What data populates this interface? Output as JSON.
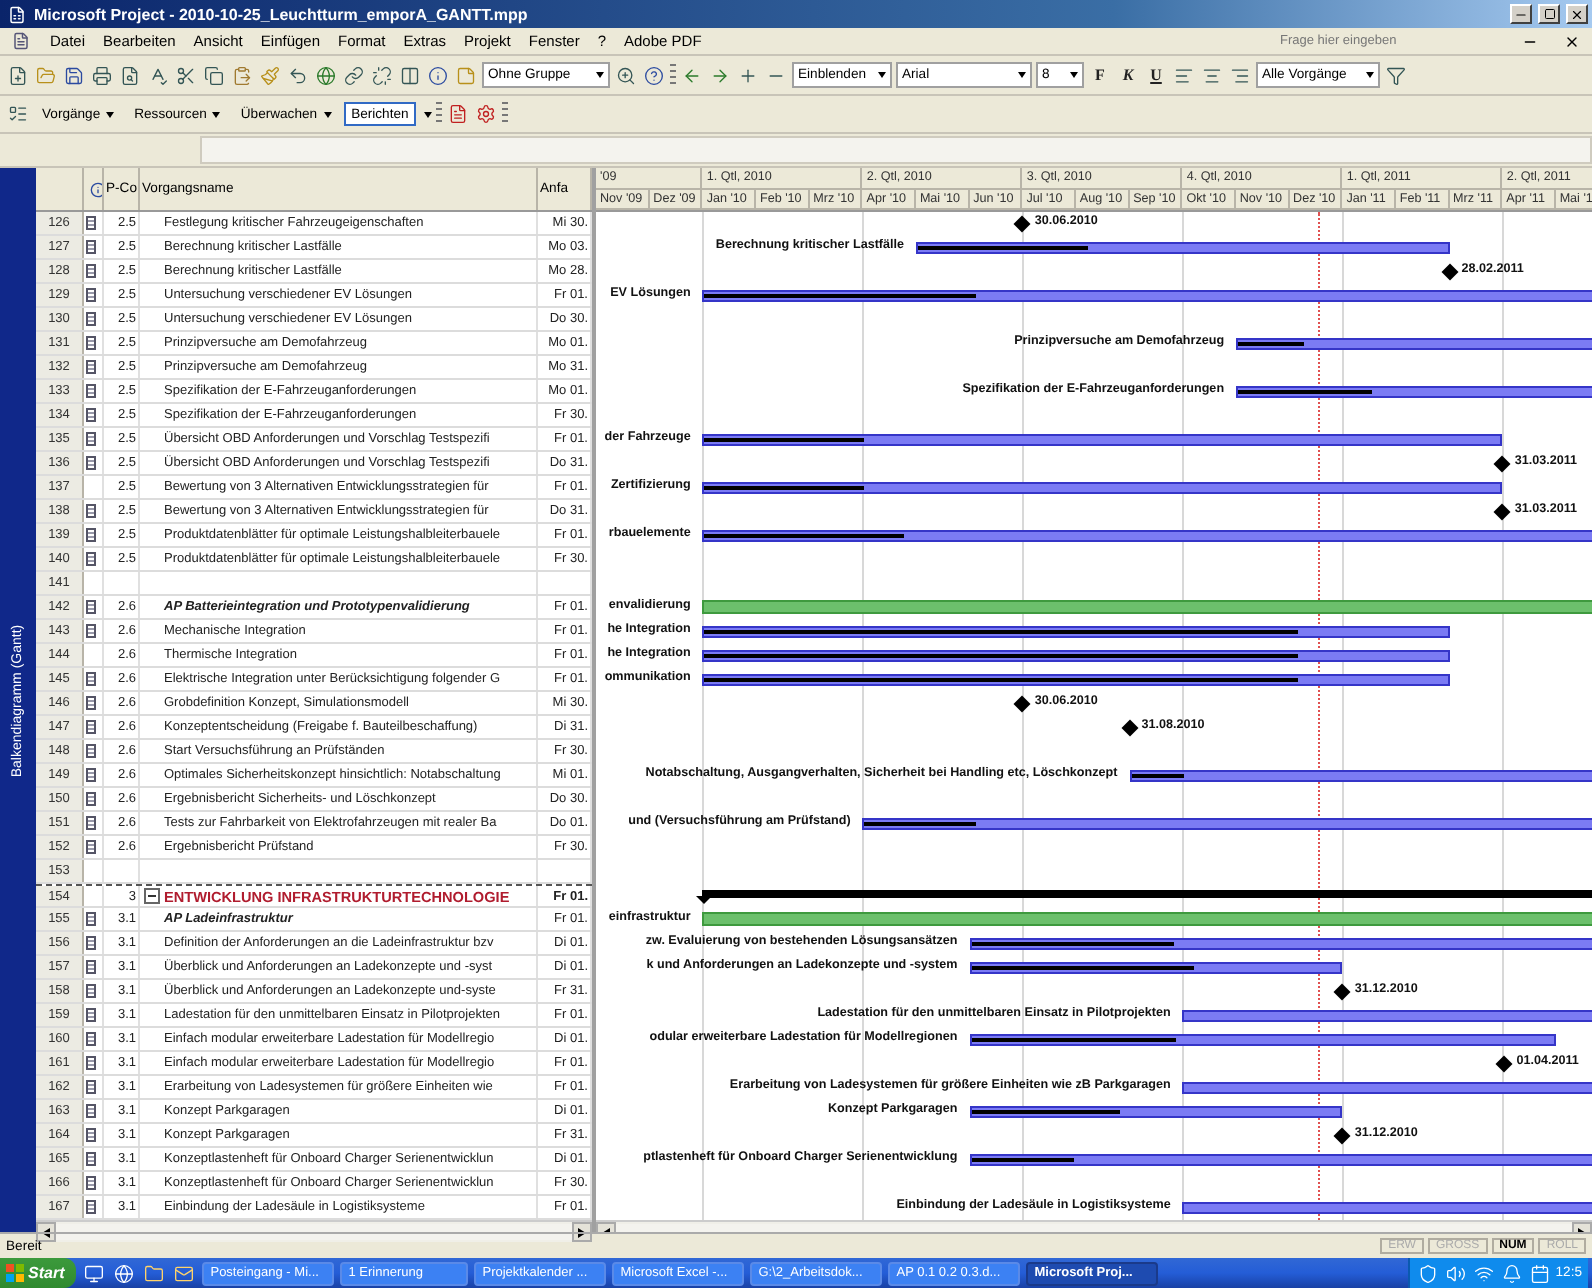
{
  "window": {
    "title": "Microsoft Project - 2010-10-25_Leuchtturm_emporA_GANTT.mpp"
  },
  "menu": [
    "Datei",
    "Bearbeiten",
    "Ansicht",
    "Einfügen",
    "Format",
    "Extras",
    "Projekt",
    "Fenster",
    "?",
    "Adobe PDF"
  ],
  "help_search": {
    "placeholder": "Frage hier eingeben"
  },
  "toolbar": {
    "group": "Ohne Gruppe",
    "show": "Einblenden",
    "font": "Arial",
    "font_size": "8",
    "bold": "F",
    "italic": "K",
    "underline": "U",
    "filter": "Alle Vorgänge"
  },
  "guide_toolbar": [
    {
      "label": "Vorgänge",
      "selected": false
    },
    {
      "label": "Ressourcen",
      "selected": false
    },
    {
      "label": "Überwachen",
      "selected": false
    },
    {
      "label": "Berichten",
      "selected": true
    }
  ],
  "view_bar": {
    "label": "Balkendiagramm (Gantt)"
  },
  "table": {
    "columns": [
      "P-Co",
      "Vorgangsname",
      "Anfa"
    ],
    "rows": [
      {
        "id": "126",
        "note": true,
        "pcode": "2.5",
        "name": "Festlegung kritischer Fahrzeugeigenschaften",
        "start": "Mi 30.",
        "kind": "task",
        "gantt": {
          "kind": "milestone",
          "label": "30.06.2010"
        }
      },
      {
        "id": "127",
        "note": true,
        "pcode": "2.5",
        "name": "Berechnung kritischer Lastfälle",
        "start": "Mo 03.",
        "kind": "task",
        "gantt": {
          "kind": "bar",
          "level": 0.32,
          "label": "Berechnung kritischer Lastfälle"
        }
      },
      {
        "id": "128",
        "note": true,
        "pcode": "2.5",
        "name": "Berechnung kritischer Lastfälle",
        "start": "Mo 28.",
        "kind": "task",
        "gantt": {
          "kind": "milestone",
          "label": "28.02.2011"
        }
      },
      {
        "id": "129",
        "note": true,
        "pcode": "2.5",
        "name": "Untersuchung verschiedener EV Lösungen",
        "start": "Fr 01.",
        "kind": "task",
        "gantt": {
          "kind": "bar",
          "level": 0.3,
          "label": "EV Lösungen"
        }
      },
      {
        "id": "130",
        "note": true,
        "pcode": "2.5",
        "name": "Untersuchung verschiedener EV Lösungen",
        "start": "Do 30.",
        "kind": "task"
      },
      {
        "id": "131",
        "note": true,
        "pcode": "2.5",
        "name": "Prinzipversuche am Demofahrzeug",
        "start": "Mo 01.",
        "kind": "task",
        "gantt": {
          "kind": "bar",
          "level": 0.18,
          "label": "Prinzipversuche am Demofahrzeug"
        }
      },
      {
        "id": "132",
        "note": true,
        "pcode": "2.5",
        "name": "Prinzipversuche am Demofahrzeug",
        "start": "Mo 31.",
        "kind": "task"
      },
      {
        "id": "133",
        "note": true,
        "pcode": "2.5",
        "name": "Spezifikation der E-Fahrzeuganforderungen",
        "start": "Mo 01.",
        "kind": "task",
        "gantt": {
          "kind": "bar",
          "level": 0.36,
          "label": "Spezifikation der E-Fahrzeuganforderungen"
        }
      },
      {
        "id": "134",
        "note": true,
        "pcode": "2.5",
        "name": "Spezifikation der E-Fahrzeuganforderungen",
        "start": "Fr 30.",
        "kind": "task"
      },
      {
        "id": "135",
        "note": true,
        "pcode": "2.5",
        "name": "Übersicht OBD Anforderungen und Vorschlag Testspezifi",
        "start": "Fr 01.",
        "kind": "task",
        "gantt": {
          "kind": "bar",
          "level": 0.2,
          "label": "der Fahrzeuge"
        }
      },
      {
        "id": "136",
        "note": true,
        "pcode": "2.5",
        "name": "Übersicht OBD Anforderungen und Vorschlag Testspezifi",
        "start": "Do 31.",
        "kind": "task",
        "gantt": {
          "kind": "milestone",
          "label": "31.03.2011"
        }
      },
      {
        "id": "137",
        "note": false,
        "pcode": "2.5",
        "name": "Bewertung von 3 Alternativen Entwicklungsstrategien für",
        "start": "Fr 01.",
        "kind": "task",
        "gantt": {
          "kind": "bar",
          "level": 0.2,
          "label": "Zertifizierung"
        }
      },
      {
        "id": "138",
        "note": true,
        "pcode": "2.5",
        "name": "Bewertung von 3 Alternativen Entwicklungsstrategien für",
        "start": "Do 31.",
        "kind": "task",
        "gantt": {
          "kind": "milestone",
          "label": "31.03.2011"
        }
      },
      {
        "id": "139",
        "note": true,
        "pcode": "2.5",
        "name": "Produktdatenblätter für optimale Leistungshalbleiterbauele",
        "start": "Fr 01.",
        "kind": "task",
        "gantt": {
          "kind": "bar",
          "level": 0.22,
          "label": "rbauelemente"
        }
      },
      {
        "id": "140",
        "note": true,
        "pcode": "2.5",
        "name": "Produktdatenblätter für optimale Leistungshalbleiterbauele",
        "start": "Fr 30.",
        "kind": "task"
      },
      {
        "id": "141",
        "note": false,
        "kind": "empty"
      },
      {
        "id": "142",
        "note": true,
        "pcode": "2.6",
        "name": "AP Batterieintegration und Prototypenvalidierung",
        "start": "Fr 01.",
        "kind": "ap",
        "gantt": {
          "kind": "ap-bar",
          "label": "envalidierung"
        }
      },
      {
        "id": "143",
        "note": true,
        "pcode": "2.6",
        "name": "Mechanische Integration",
        "start": "Fr 01.",
        "kind": "task",
        "gantt": {
          "kind": "bar",
          "level": 0.8,
          "label": "he Integration"
        }
      },
      {
        "id": "144",
        "note": false,
        "pcode": "2.6",
        "name": "Thermische Integration",
        "start": "Fr 01.",
        "kind": "task",
        "gantt": {
          "kind": "bar",
          "level": 0.8,
          "label": "he Integration"
        }
      },
      {
        "id": "145",
        "note": true,
        "pcode": "2.6",
        "name": "Elektrische Integration unter Berücksichtigung folgender G",
        "start": "Fr 01.",
        "kind": "task",
        "gantt": {
          "kind": "bar",
          "level": 0.8,
          "label": "ommunikation"
        }
      },
      {
        "id": "146",
        "note": true,
        "pcode": "2.6",
        "name": "Grobdefinition Konzept, Simulationsmodell",
        "start": "Mi 30.",
        "kind": "task",
        "gantt": {
          "kind": "milestone",
          "label": "30.06.2010"
        }
      },
      {
        "id": "147",
        "note": true,
        "pcode": "2.6",
        "name": "Konzeptentscheidung (Freigabe f. Bauteilbeschaffung)",
        "start": "Di 31.",
        "kind": "task",
        "gantt": {
          "kind": "milestone",
          "label": "31.08.2010"
        }
      },
      {
        "id": "148",
        "note": true,
        "pcode": "2.6",
        "name": "Start Versuchsführung an Prüfständen",
        "start": "Fr 30.",
        "kind": "task"
      },
      {
        "id": "149",
        "note": true,
        "pcode": "2.6",
        "name": "Optimales Sicherheitskonzept hinsichtlich: Notabschaltung",
        "start": "Mi 01.",
        "kind": "task",
        "gantt": {
          "kind": "bar",
          "level": 0.11,
          "label": "Notabschaltung, Ausgangverhalten, Sicherheit bei Handling etc, Löschkonzept"
        }
      },
      {
        "id": "150",
        "note": true,
        "pcode": "2.6",
        "name": "Ergebnisbericht Sicherheits- und Löschkonzept",
        "start": "Do 30.",
        "kind": "task"
      },
      {
        "id": "151",
        "note": true,
        "pcode": "2.6",
        "name": "Tests zur Fahrbarkeit von Elektrofahrzeugen mit realer Ba",
        "start": "Do 01.",
        "kind": "task",
        "gantt": {
          "kind": "bar",
          "level": 0.15,
          "label": "und (Versuchsführung am Prüfstand)"
        }
      },
      {
        "id": "152",
        "note": true,
        "pcode": "2.6",
        "name": "Ergebnisbericht Prüfstand",
        "start": "Fr 30.",
        "kind": "task"
      },
      {
        "id": "153",
        "note": false,
        "kind": "empty"
      },
      {
        "id": "154",
        "note": false,
        "pcode": "3",
        "name": "ENTWICKLUNG INFRASTRUKTURTECHNOLOGIE",
        "start": "Fr 01.",
        "kind": "phase",
        "expanded": true,
        "gantt": {
          "kind": "summary"
        }
      },
      {
        "id": "155",
        "note": true,
        "pcode": "3.1",
        "name": "AP Ladeinfrastruktur",
        "start": "Fr 01.",
        "kind": "ap",
        "gantt": {
          "kind": "ap-bar",
          "label": "einfrastruktur"
        }
      },
      {
        "id": "156",
        "note": true,
        "pcode": "3.1",
        "name": "Definition der Anforderungen an die Ladeinfrastruktur bzv",
        "start": "Di 01.",
        "kind": "task",
        "gantt": {
          "kind": "bar",
          "level": 0.32,
          "label": "zw. Evaluierung von bestehenden Lösungsansätzen"
        }
      },
      {
        "id": "157",
        "note": true,
        "pcode": "3.1",
        "name": "Überblick und Anforderungen an Ladekonzepte und -syst",
        "start": "Di 01.",
        "kind": "task",
        "gantt": {
          "kind": "bar",
          "level": 0.6,
          "label": "k und Anforderungen an Ladekonzepte und -system"
        }
      },
      {
        "id": "158",
        "note": true,
        "pcode": "3.1",
        "name": "Überblick und Anforderungen an Ladekonzepte und-syste",
        "start": "Fr 31.",
        "kind": "task",
        "gantt": {
          "kind": "milestone",
          "label": "31.12.2010"
        }
      },
      {
        "id": "159",
        "note": true,
        "pcode": "3.1",
        "name": "Ladestation für den unmittelbaren Einsatz in Pilotprojekten",
        "start": "Fr 01.",
        "kind": "task",
        "gantt": {
          "kind": "bar",
          "label": "Ladestation für den unmittelbaren Einsatz in Pilotprojekten"
        }
      },
      {
        "id": "160",
        "note": true,
        "pcode": "3.1",
        "name": "Einfach modular erweiterbare Ladestation für Modellregio",
        "start": "Di 01.",
        "kind": "task",
        "gantt": {
          "kind": "bar",
          "level": 0.35,
          "label": "odular erweiterbare Ladestation für Modellregionen"
        }
      },
      {
        "id": "161",
        "note": true,
        "pcode": "3.1",
        "name": "Einfach modular erweiterbare Ladestation für Modellregio",
        "start": "Fr 01.",
        "kind": "task",
        "gantt": {
          "kind": "milestone",
          "label": "01.04.2011"
        }
      },
      {
        "id": "162",
        "note": true,
        "pcode": "3.1",
        "name": "Erarbeitung von Ladesystemen für größere Einheiten wie",
        "start": "Fr 01.",
        "kind": "task",
        "gantt": {
          "kind": "bar",
          "label": "Erarbeitung von Ladesystemen für größere Einheiten wie zB Parkgaragen"
        }
      },
      {
        "id": "163",
        "note": true,
        "pcode": "3.1",
        "name": "Konzept Parkgaragen",
        "start": "Di 01.",
        "kind": "task",
        "gantt": {
          "kind": "bar",
          "level": 0.4,
          "label": "Konzept Parkgaragen"
        }
      },
      {
        "id": "164",
        "note": true,
        "pcode": "3.1",
        "name": "Konzept Parkgaragen",
        "start": "Fr 31.",
        "kind": "task",
        "gantt": {
          "kind": "milestone",
          "label": "31.12.2010"
        }
      },
      {
        "id": "165",
        "note": true,
        "pcode": "3.1",
        "name": "Konzeptlastenheft für Onboard Charger Serienentwicklun",
        "start": "Di 01.",
        "kind": "task",
        "gantt": {
          "kind": "bar",
          "level": 0.16,
          "label": "ptlastenheft für Onboard Charger Serienentwicklung"
        }
      },
      {
        "id": "166",
        "note": true,
        "pcode": "3.1",
        "name": "Konzeptlastenheft für Onboard Charger Serienentwicklun",
        "start": "Fr 30.",
        "kind": "task"
      },
      {
        "id": "167",
        "note": true,
        "pcode": "3.1",
        "name": "Einbindung der Ladesäule in Logistiksysteme",
        "start": "Fr 01.",
        "kind": "task",
        "gantt": {
          "kind": "bar",
          "label": "Einbindung der Ladesäule in Logistiksysteme"
        }
      }
    ]
  },
  "gantt": {
    "quarters": [
      "'09",
      "1. Qtl, 2010",
      "2. Qtl, 2010",
      "3. Qtl, 2010",
      "4. Qtl, 2010",
      "1. Qtl, 2011",
      "2. Qtl, 2011"
    ],
    "months": [
      "Nov '09",
      "Dez '09",
      "Jan '10",
      "Feb '10",
      "Mrz '10",
      "Apr '10",
      "Mai '10",
      "Jun '10",
      "Jul '10",
      "Aug '10",
      "Sep '10",
      "Okt '10",
      "Nov '10",
      "Dez '10",
      "Jan '11",
      "Feb '11",
      "Mrz '11",
      "Apr '11",
      "Mai '1"
    ]
  },
  "status_bar": {
    "text": "Bereit",
    "indicators": [
      {
        "label": "ERW",
        "on": false
      },
      {
        "label": "GROSS",
        "on": false
      },
      {
        "label": "NUM",
        "on": true
      },
      {
        "label": "ROLL",
        "on": false
      }
    ]
  },
  "taskbar": {
    "start": "Start",
    "tasks": [
      {
        "label": "Posteingang - Mi...",
        "selected": false
      },
      {
        "label": "1 Erinnerung",
        "selected": false
      },
      {
        "label": "Projektkalender ...",
        "selected": false
      },
      {
        "label": "Microsoft Excel -...",
        "selected": false
      },
      {
        "label": "G:\\2_Arbeitsdok...",
        "selected": false
      },
      {
        "label": "AP 0.1 0.2 0.3.d...",
        "selected": false
      },
      {
        "label": "Microsoft Proj...",
        "selected": true
      }
    ],
    "clock": "12:5"
  }
}
